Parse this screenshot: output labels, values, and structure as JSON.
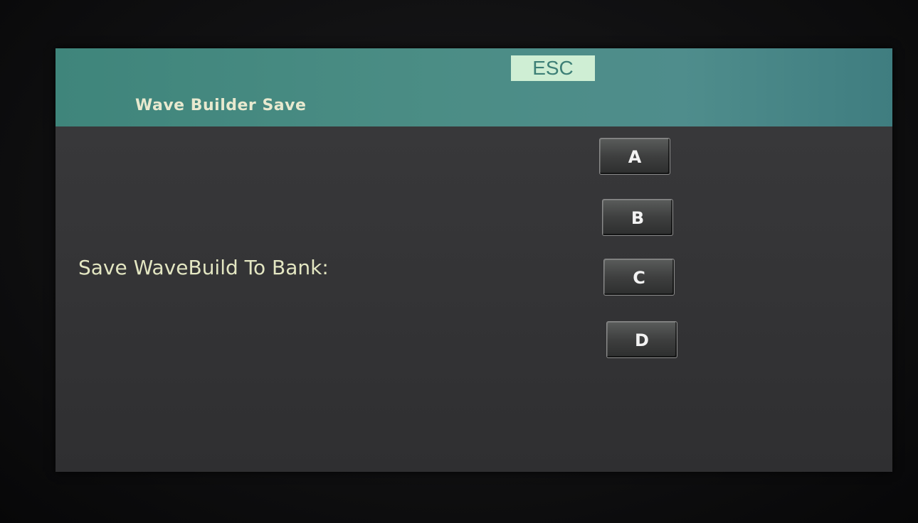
{
  "header": {
    "title": "Wave Builder Save",
    "esc_label": "ESC"
  },
  "main": {
    "prompt": "Save WaveBuild To Bank:",
    "banks": [
      "A",
      "B",
      "C",
      "D"
    ]
  },
  "colors": {
    "header_teal": "#4b8d85",
    "esc_bg": "#cfeed4",
    "text_cream": "#e3e6c2",
    "screen_bg": "#363638"
  }
}
